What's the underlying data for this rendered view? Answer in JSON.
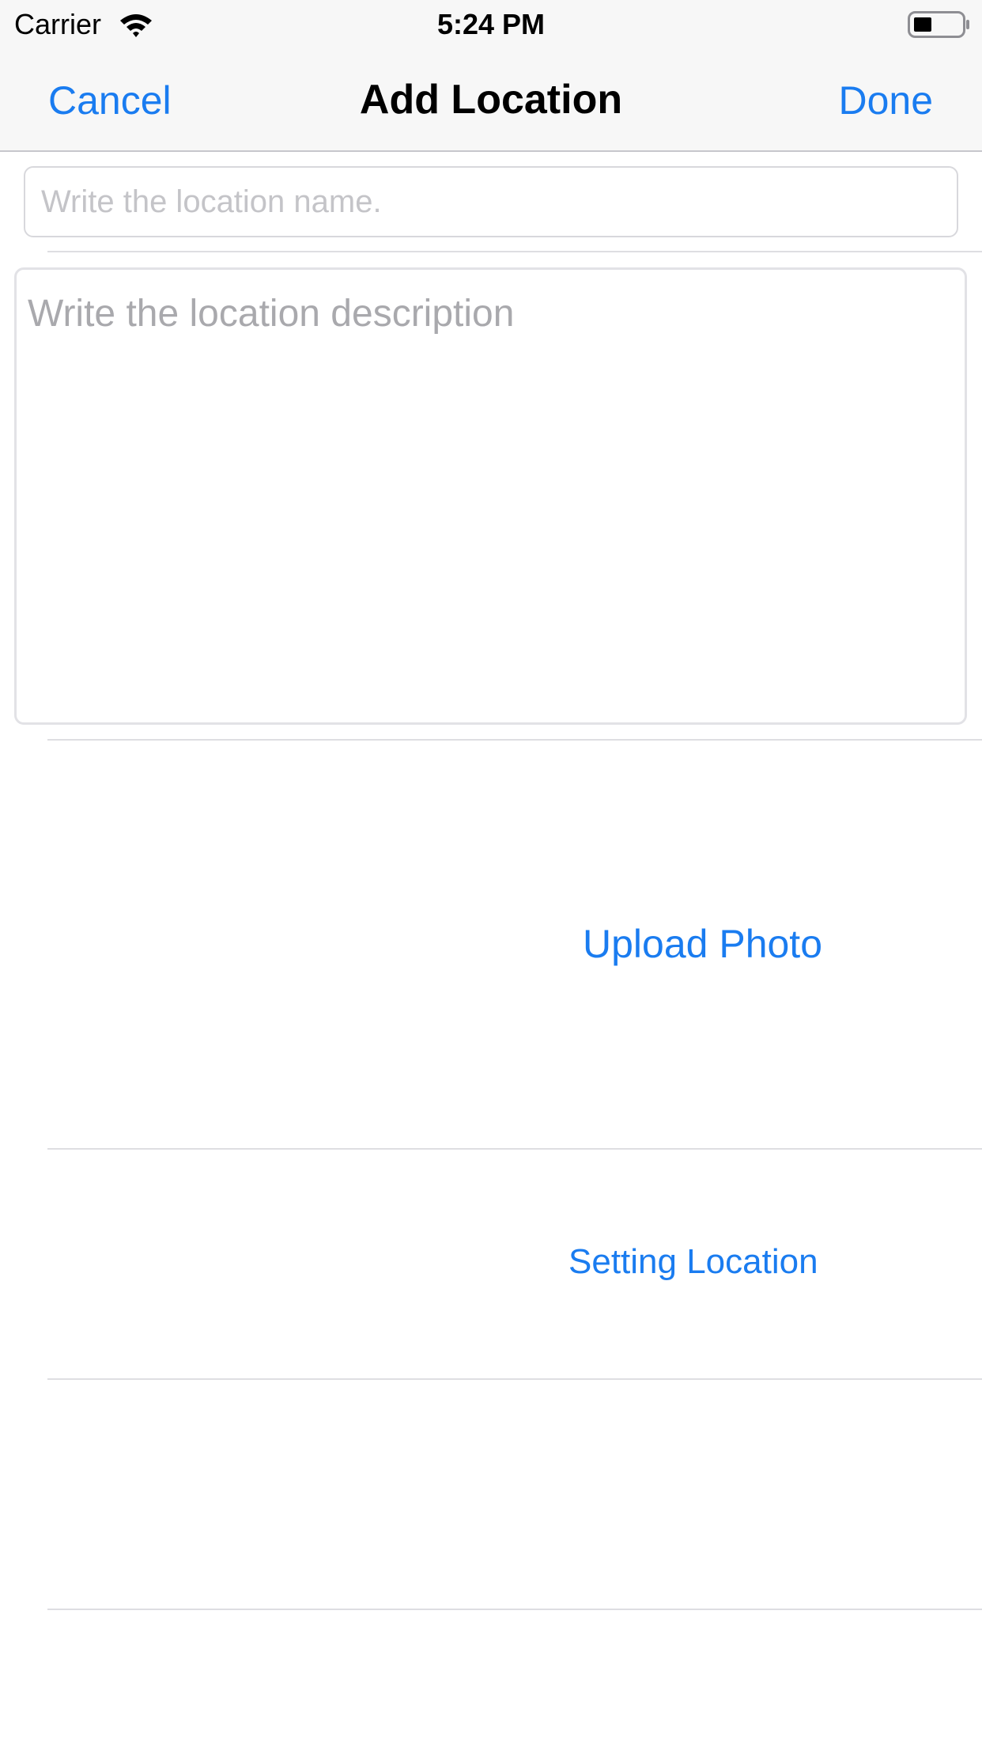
{
  "status_bar": {
    "carrier": "Carrier",
    "time": "5:24 PM",
    "wifi_icon": "wifi-icon",
    "battery_icon": "battery-icon"
  },
  "nav": {
    "cancel_label": "Cancel",
    "title": "Add Location",
    "done_label": "Done"
  },
  "form": {
    "name_value": "",
    "name_placeholder": "Write the location name.",
    "description_value": "",
    "description_placeholder": "Write the location description"
  },
  "actions": {
    "upload_photo_label": "Upload Photo",
    "setting_location_label": "Setting Location"
  },
  "colors": {
    "accent": "#1a7cf0",
    "bar_background": "#f7f7f7",
    "separator": "#dedee2"
  }
}
